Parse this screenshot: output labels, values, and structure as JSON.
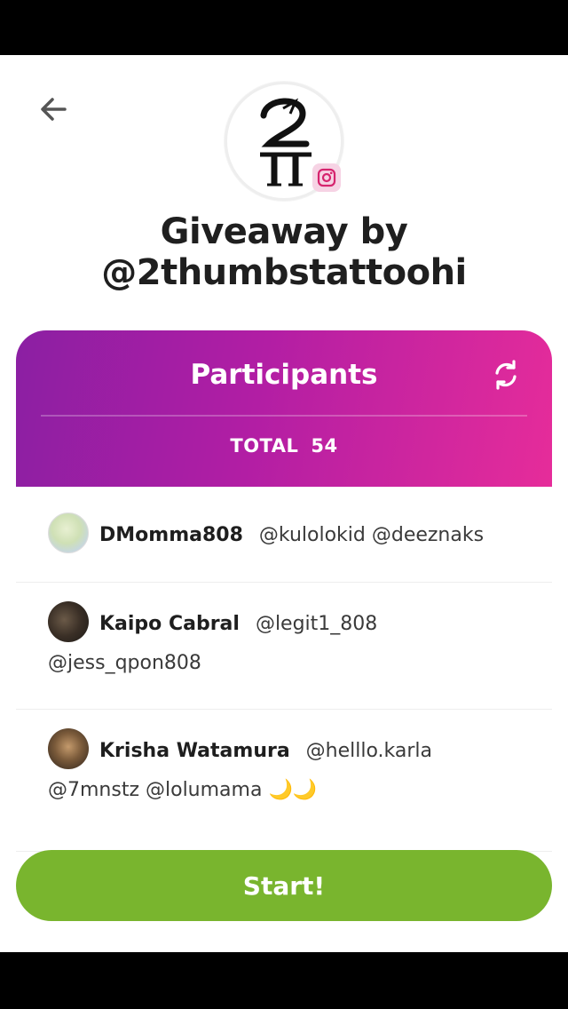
{
  "header": {
    "title_line1": "Giveaway by",
    "title_line2": "@2thumbstattoohi"
  },
  "icons": {
    "back": "arrow-left-icon",
    "instagram": "instagram-icon",
    "refresh": "refresh-icon"
  },
  "participants": {
    "title": "Participants",
    "total_label": "TOTAL",
    "total_count": "54",
    "items": [
      {
        "name": "DMomma808",
        "comment": "@kulolokid @deeznaks"
      },
      {
        "name": "Kaipo Cabral",
        "comment": "@legit1_808 @jess_qpon808"
      },
      {
        "name": "Krisha Watamura",
        "comment": "@helllo.karla @7mnstz @lolumama 🌙🌙"
      }
    ]
  },
  "actions": {
    "start_label": "Start!"
  },
  "colors": {
    "header_gradient_start": "#8b1fa3",
    "header_gradient_end": "#e62c9a",
    "start_button": "#79b52e"
  }
}
